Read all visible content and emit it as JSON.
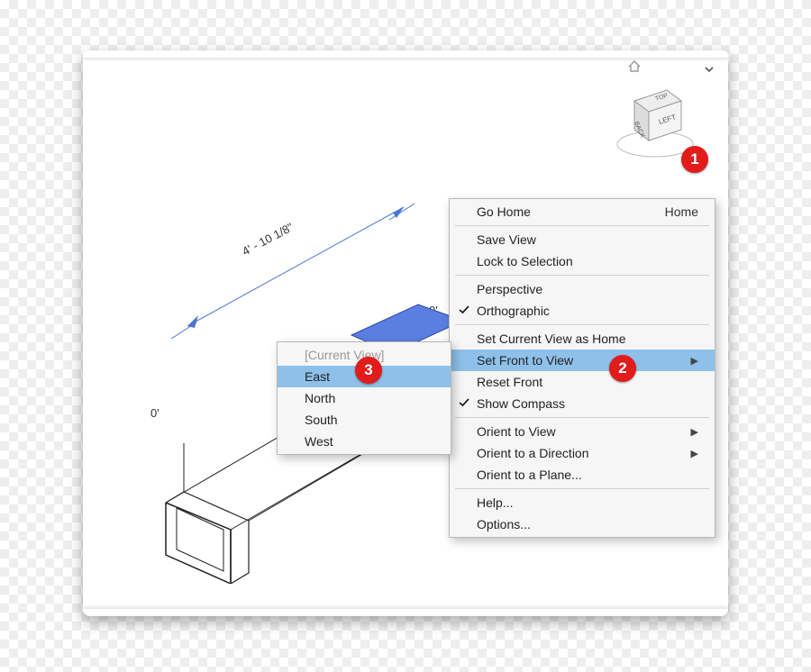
{
  "callouts": {
    "c1": "1",
    "c2": "2",
    "c3": "3"
  },
  "viewcube": {
    "top": "TOP",
    "back": "BACK",
    "left": "LEFT"
  },
  "dims": {
    "len": "4' - 10 1/8\"",
    "w": "0'",
    "h": "0'"
  },
  "menu": {
    "go_home": "Go Home",
    "go_home_sc": "Home",
    "save_view": "Save View",
    "lock_sel": "Lock to Selection",
    "perspective": "Perspective",
    "orthographic": "Orthographic",
    "set_home": "Set Current View as Home",
    "set_front": "Set Front to View",
    "reset_front": "Reset Front",
    "show_compass": "Show Compass",
    "orient_view": "Orient to View",
    "orient_dir": "Orient to a Direction",
    "orient_plane": "Orient to a Plane...",
    "help": "Help...",
    "options": "Options..."
  },
  "submenu": {
    "current": "[Current View]",
    "east": "East",
    "north": "North",
    "south": "South",
    "west": "West"
  }
}
